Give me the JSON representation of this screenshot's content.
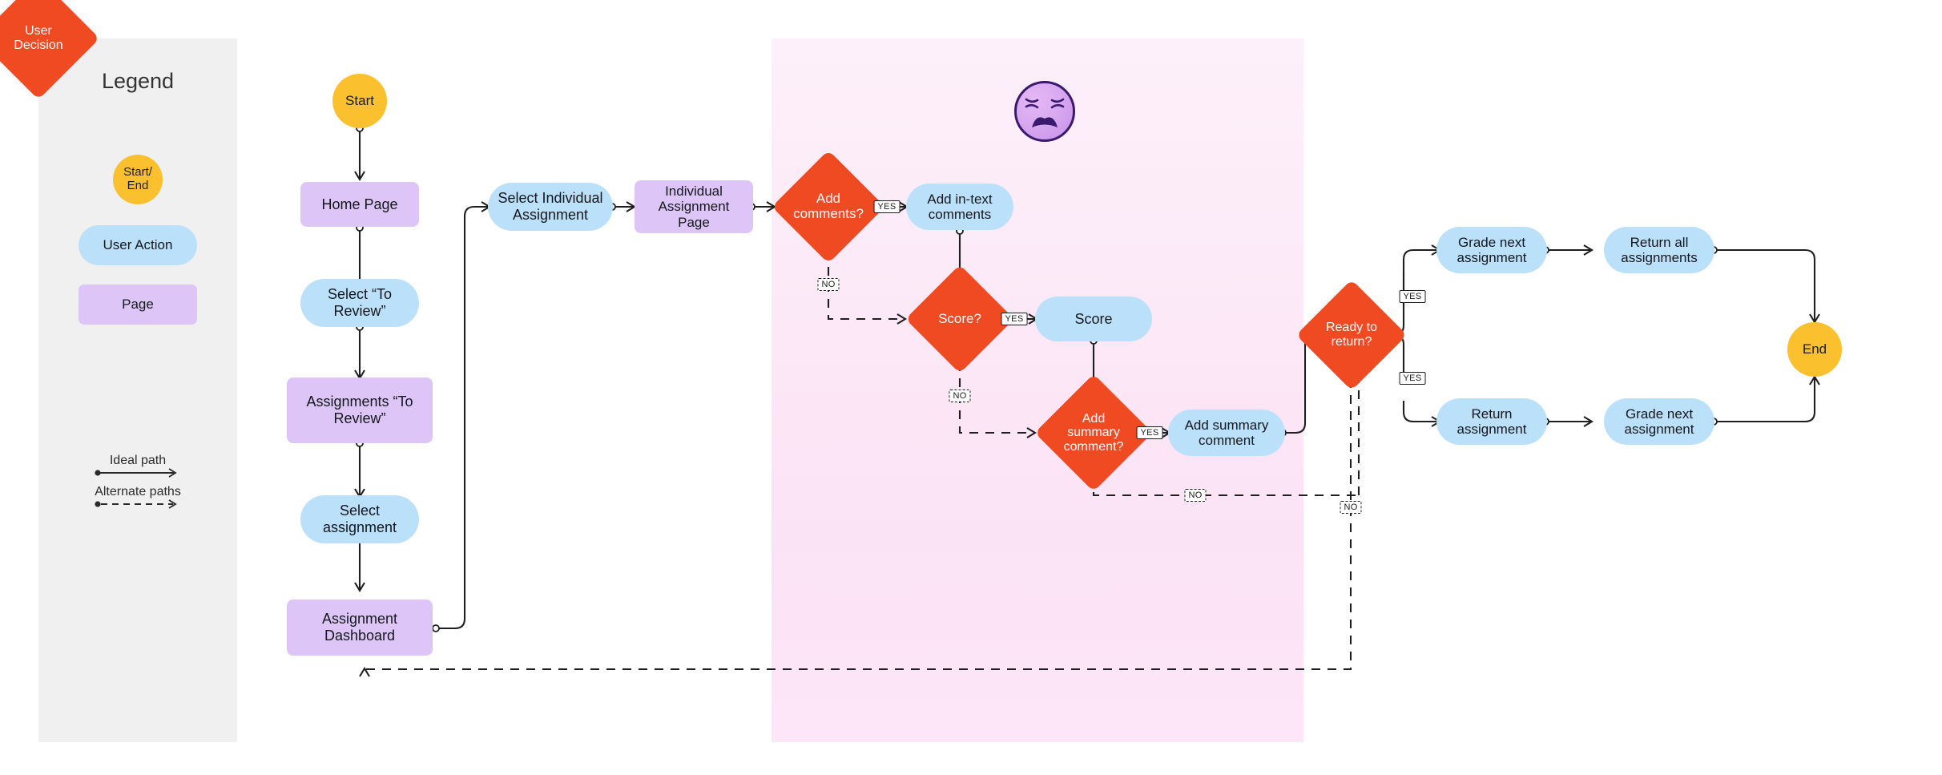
{
  "diagram": {
    "title": "Assignment grading workflow flowchart",
    "colors": {
      "terminal": "#FBC02D",
      "user_action": "#BBE1FA",
      "page": "#DDC6F7",
      "user_decision": "#F04A23",
      "legend_panel": "#F0F0F0",
      "highlight_zone": "#FCE6F7",
      "edge": "#1F1F1F"
    }
  },
  "legend": {
    "title": "Legend",
    "items": [
      {
        "key": "terminal",
        "label": "Start/\nEnd",
        "label_line1": "Start/",
        "label_line2": "End",
        "shape": "circle"
      },
      {
        "key": "user_action",
        "label": "User Action",
        "shape": "stadium"
      },
      {
        "key": "page",
        "label": "Page",
        "shape": "rounded-rect"
      },
      {
        "key": "user_decision",
        "label_line1": "User",
        "label_line2": "Decision",
        "shape": "diamond"
      }
    ],
    "paths": [
      {
        "key": "ideal",
        "label": "Ideal path",
        "style": "solid",
        "icon": "arrow-right-icon"
      },
      {
        "key": "alternate",
        "label": "Alternate paths",
        "style": "dashed",
        "icon": "dashed-arrow-right-icon"
      }
    ]
  },
  "highlight_zone": {
    "annotation_icon": "weary-face-emoji",
    "annotation_meaning": "frustration / pain point"
  },
  "nodes": {
    "start": {
      "label": "Start",
      "type": "terminal"
    },
    "home_page": {
      "label": "Home Page",
      "type": "page"
    },
    "select_to_review": {
      "line1": "Select “To",
      "line2": "Review”",
      "type": "user_action"
    },
    "assignments_to_review": {
      "line1": "Assignments “To",
      "line2": "Review”",
      "type": "page"
    },
    "select_assignment": {
      "line1": "Select",
      "line2": "assignment",
      "type": "user_action"
    },
    "assignment_dashboard": {
      "line1": "Assignment",
      "line2": "Dashboard",
      "type": "page"
    },
    "select_individual": {
      "line1": "Select Individual",
      "line2": "Assignment",
      "type": "user_action"
    },
    "individual_page": {
      "line1": "Individual",
      "line2": "Assignment",
      "line3": "Page",
      "type": "page"
    },
    "add_comments_q": {
      "line1": "Add",
      "line2": "comments?",
      "type": "user_decision"
    },
    "add_intext": {
      "line1": "Add in-text",
      "line2": "comments",
      "type": "user_action"
    },
    "score_q": {
      "label": "Score?",
      "type": "user_decision"
    },
    "score": {
      "label": "Score",
      "type": "user_action"
    },
    "add_summary_q": {
      "line1": "Add",
      "line2": "summary",
      "line3": "comment?",
      "type": "user_decision"
    },
    "add_summary": {
      "line1": "Add summary",
      "line2": "comment",
      "type": "user_action"
    },
    "ready_q": {
      "line1": "Ready to",
      "line2": "return?",
      "type": "user_decision"
    },
    "grade_next_top": {
      "line1": "Grade next",
      "line2": "assignment",
      "type": "user_action"
    },
    "return_all": {
      "line1": "Return all",
      "line2": "assignments",
      "type": "user_action"
    },
    "return_assignment": {
      "line1": "Return",
      "line2": "assignment",
      "type": "user_action"
    },
    "grade_next_bottom": {
      "line1": "Grade next",
      "line2": "assignment",
      "type": "user_action"
    },
    "end": {
      "label": "End",
      "type": "terminal"
    }
  },
  "edge_labels": {
    "comments_yes": "YES",
    "comments_no": "NO",
    "score_yes": "YES",
    "score_no": "NO",
    "summary_yes": "YES",
    "summary_no": "NO",
    "ready_yes_top": "YES",
    "ready_yes_bottom": "YES",
    "ready_no": "NO"
  },
  "flow": {
    "edges": [
      {
        "from": "start",
        "to": "home_page",
        "style": "solid"
      },
      {
        "from": "home_page",
        "to": "select_to_review",
        "style": "solid"
      },
      {
        "from": "select_to_review",
        "to": "assignments_to_review",
        "style": "solid"
      },
      {
        "from": "assignments_to_review",
        "to": "select_assignment",
        "style": "solid"
      },
      {
        "from": "select_assignment",
        "to": "assignment_dashboard",
        "style": "solid"
      },
      {
        "from": "assignment_dashboard",
        "to": "select_individual",
        "style": "solid"
      },
      {
        "from": "select_individual",
        "to": "individual_page",
        "style": "solid"
      },
      {
        "from": "individual_page",
        "to": "add_comments_q",
        "style": "solid"
      },
      {
        "from": "add_comments_q",
        "to": "add_intext",
        "style": "solid",
        "label": "YES"
      },
      {
        "from": "add_comments_q",
        "to": "score_q",
        "style": "dashed",
        "label": "NO"
      },
      {
        "from": "add_intext",
        "to": "score_q",
        "style": "solid"
      },
      {
        "from": "score_q",
        "to": "score",
        "style": "solid",
        "label": "YES"
      },
      {
        "from": "score_q",
        "to": "add_summary_q",
        "style": "dashed",
        "label": "NO"
      },
      {
        "from": "score",
        "to": "add_summary_q",
        "style": "solid"
      },
      {
        "from": "add_summary_q",
        "to": "add_summary",
        "style": "solid",
        "label": "YES"
      },
      {
        "from": "add_summary_q",
        "to": "ready_q",
        "style": "dashed",
        "label": "NO"
      },
      {
        "from": "add_summary",
        "to": "ready_q",
        "style": "solid"
      },
      {
        "from": "ready_q",
        "to": "grade_next_top",
        "style": "solid",
        "label": "YES"
      },
      {
        "from": "ready_q",
        "to": "return_assignment",
        "style": "solid",
        "label": "YES"
      },
      {
        "from": "ready_q",
        "to": "assignment_dashboard",
        "style": "dashed",
        "label": "NO"
      },
      {
        "from": "grade_next_top",
        "to": "return_all",
        "style": "solid"
      },
      {
        "from": "return_all",
        "to": "end",
        "style": "solid"
      },
      {
        "from": "return_assignment",
        "to": "grade_next_bottom",
        "style": "solid"
      },
      {
        "from": "grade_next_bottom",
        "to": "end",
        "style": "solid"
      }
    ]
  }
}
